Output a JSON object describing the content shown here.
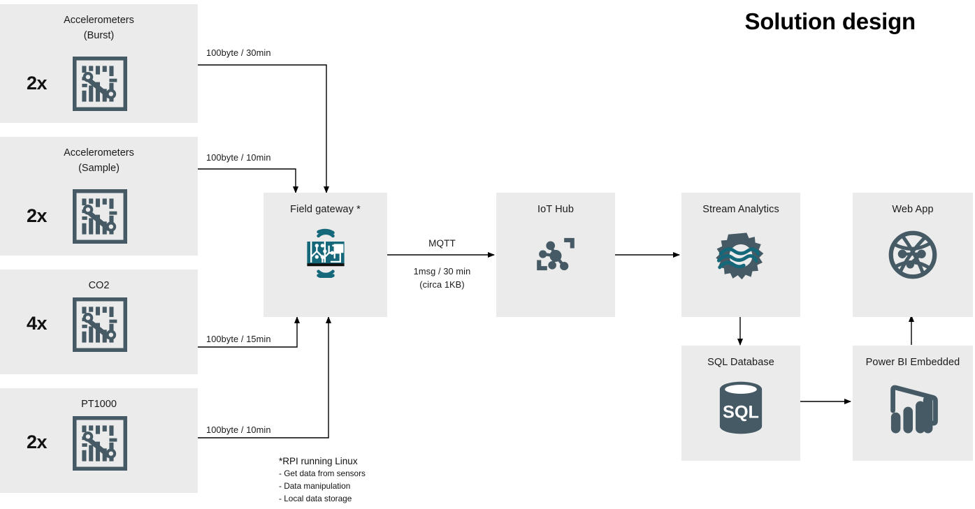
{
  "title": "Solution design",
  "colors": {
    "box_bg": "#ebebeb",
    "icon_dark": "#455A64",
    "icon_teal": "#14687A",
    "line": "#000000",
    "page_bg": "#ffffff"
  },
  "sensors": [
    {
      "name": "accelerometers-burst",
      "label": "Accelerometers\n(Burst)",
      "count": "2x",
      "icon": "circuit-chip-icon"
    },
    {
      "name": "accelerometers-sample",
      "label": "Accelerometers\n(Sample)",
      "count": "2x",
      "icon": "circuit-chip-icon"
    },
    {
      "name": "co2",
      "label": "CO2",
      "count": "4x",
      "icon": "circuit-chip-icon"
    },
    {
      "name": "pt1000",
      "label": "PT1000",
      "count": "2x",
      "icon": "circuit-chip-icon"
    }
  ],
  "nodes": {
    "field_gateway": {
      "label": "Field gateway *",
      "icon": "gateway-board-icon"
    },
    "iot_hub": {
      "label": "IoT Hub",
      "icon": "iot-hub-icon"
    },
    "stream_analytics": {
      "label": "Stream Analytics",
      "icon": "stream-analytics-gear-icon"
    },
    "web_app": {
      "label": "Web App",
      "icon": "web-globe-icon"
    },
    "sql_database": {
      "label": "SQL Database",
      "icon": "sql-cylinder-icon"
    },
    "power_bi": {
      "label": "Power BI Embedded",
      "icon": "power-bi-icon"
    }
  },
  "edges": {
    "burst_to_gateway": "100byte / 30min",
    "sample_to_gateway": "100byte / 10min",
    "co2_to_gateway": "100byte / 15min",
    "pt1000_to_gateway": "100byte / 10min",
    "gateway_to_hub_protocol": "MQTT",
    "gateway_to_hub_rate": "1msg / 30 min",
    "gateway_to_hub_size": "(circa 1KB)"
  },
  "footnote": {
    "heading": "*RPI running Linux",
    "items": [
      "- Get data from sensors",
      "- Data manipulation",
      "- Local data storage"
    ]
  }
}
